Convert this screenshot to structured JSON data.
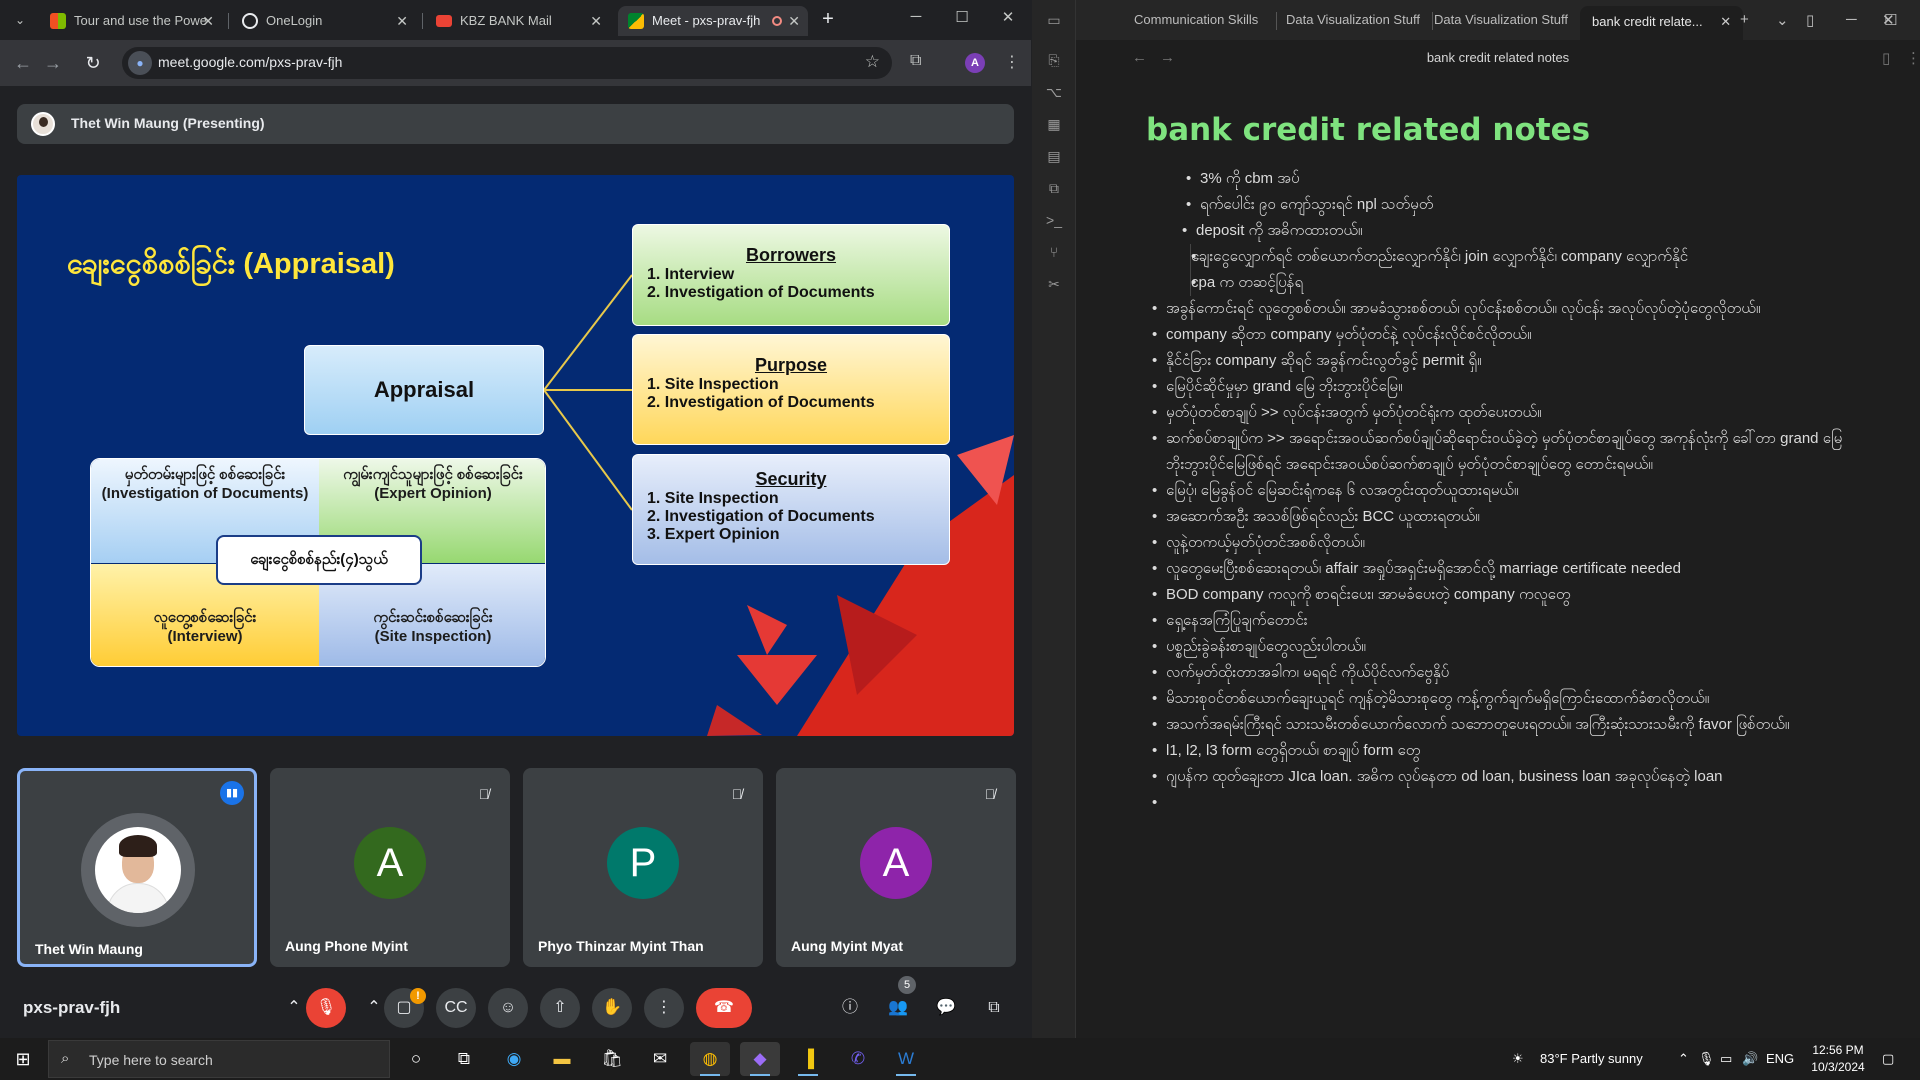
{
  "chrome": {
    "tabs": [
      {
        "label": "Tour and use the Powe",
        "active": false,
        "favicon_color": "#f25022"
      },
      {
        "label": "OneLogin",
        "active": false,
        "favicon_color": "#e8eaed"
      },
      {
        "label": "KBZ BANK Mail",
        "active": false,
        "favicon_color": "#ea4335"
      },
      {
        "label": "Meet - pxs-prav-fjh",
        "active": true,
        "favicon_color": "#00832d"
      }
    ],
    "url": "meet.google.com/pxs-prav-fjh",
    "profile_initial": "A"
  },
  "meet": {
    "presenter_label": "Thet Win Maung (Presenting)",
    "meeting_code": "pxs-prav-fjh",
    "participant_count": "5",
    "warning_count": "!",
    "slide": {
      "title": "ချေးငွေစိစစ်ခြင်း (Appraisal)",
      "center_label": "Appraisal",
      "borrowers": {
        "heading": "Borrowers",
        "items": [
          "1. Interview",
          "2. Investigation of Documents"
        ]
      },
      "purpose": {
        "heading": "Purpose",
        "items": [
          "1. Site Inspection",
          "2. Investigation of Documents"
        ]
      },
      "security": {
        "heading": "Security",
        "items": [
          "1. Site Inspection",
          "2. Investigation of Documents",
          "3. Expert Opinion"
        ]
      },
      "quadrants": {
        "top_left": {
          "mm": "မှတ်တမ်းများဖြင့် စစ်ဆေးခြင်း",
          "en": "(Investigation of Documents)"
        },
        "top_right": {
          "mm": "ကျွမ်းကျင်သူများဖြင့် စစ်ဆေးခြင်း",
          "en": "(Expert Opinion)"
        },
        "bottom_left": {
          "mm": "လူတွေ့စစ်ဆေးခြင်း",
          "en": "(Interview)"
        },
        "bottom_right": {
          "mm": "ကွင်းဆင်းစစ်ဆေးခြင်း",
          "en": "(Site Inspection)"
        },
        "center": "ချေးငွေစိစစ်နည်း(၄)သွယ်"
      }
    },
    "participants": [
      {
        "name": "Thet Win Maung",
        "initial": "",
        "color": "#5f6368",
        "active": true
      },
      {
        "name": "Aung Phone Myint",
        "initial": "A",
        "color": "#33691e",
        "active": false
      },
      {
        "name": "Phyo Thinzar Myint Than",
        "initial": "P",
        "color": "#00796b",
        "active": false
      },
      {
        "name": "Aung Myint Myat",
        "initial": "A",
        "color": "#8e24aa",
        "active": false
      }
    ]
  },
  "notes": {
    "tabs": [
      "Communication Skills",
      "Data Visualization Stuff",
      "Data Visualization Stuff",
      "bank credit relate..."
    ],
    "doc_header": "bank credit related notes",
    "title": "bank credit related notes",
    "items": [
      {
        "text": "3% ကို cbm အပ်",
        "level": "l3"
      },
      {
        "text": "ရက်ပေါင်း ၉၀ ကျော်သွားရင် npl သတ်မှတ်",
        "level": "l3"
      },
      {
        "text": "deposit ကို အဓိကထားတယ်။",
        "level": "l4"
      },
      {
        "text": "ချေးငွေလျှောက်ရင် တစ်ယောက်တည်းလျှောက်နိုင်၊ join လျှောက်နိုင်၊ company လျှောက်နိုင်",
        "level": "nested"
      },
      {
        "text": "cpa က တဆင့်ပြန်ရ",
        "level": "nested"
      },
      {
        "text": "အခွန်ကောင်းရင် လူတွေစစ်တယ်။ အာမခံသွားစစ်တယ်၊ လုပ်ငန်းစစ်တယ်။ လုပ်ငန်း အလုပ်လုပ်တဲ့ပုံတွေလိုတယ်။",
        "level": "l2"
      },
      {
        "text": "company ဆိုတာ company မှတ်ပုံတင်နဲ့ လုပ်ငန်းလိုင်စင်လိုတယ်။",
        "level": "l2"
      },
      {
        "text": "နိုင်ငံခြား company ဆိုရင် အခွန်ကင်းလွတ်ခွင့် permit ရှိ။",
        "level": "l2"
      },
      {
        "text": "မြေပိုင်ဆိုင်မှုမှာ grand မြေ ဘိုးဘွားပိုင်မြေ။",
        "level": "l2"
      },
      {
        "text": "မှတ်ပုံတင်စာချုပ် >> လုပ်ငန်းအတွက် မှတ်ပုံတင်ရုံးက ထုတ်ပေးတယ်။",
        "level": "l2"
      },
      {
        "text": "ဆက်စပ်စာချုပ်က >> အရောင်းအဝယ်ဆက်စပ်ချုပ်ဆိုရောင်းဝယ်ခဲ့တဲ့ မှတ်ပုံတင်စာချုပ်တွေ အကုန်လုံးကို ခေါ်တာ grand မြေ ဘိုးဘွားပိုင်မြေဖြစ်ရင် အရောင်းအဝယ်စပ်ဆက်စာချုပ် မှတ်ပုံတင်စာချုပ်တွေ တောင်းရမယ်။",
        "level": "l2"
      },
      {
        "text": "မြေပုံ၊ မြေခွန်ဝင် မြေဆင်းရုံကနေ ၆ လအတွင်းထုတ်ယူထားရမယ်။",
        "level": "l2"
      },
      {
        "text": "အဆောက်အဦး အသစ်ဖြစ်ရင်လည်း BCC ယူထားရတယ်။",
        "level": "l2"
      },
      {
        "text": "လူနဲ့တကယ့်မှတ်ပုံတင်အစစ်လိုတယ်။",
        "level": "l2"
      },
      {
        "text": "လူတွေမေးပြီးစစ်ဆေးရတယ်၊ affair အရှုပ်အရှင်းမရှိအောင်လို့ marriage certificate needed",
        "level": "l2"
      },
      {
        "text": "BOD company ကလူကို စာရင်းပေး၊ အာမခံပေးတဲ့ company ကလူတွေ",
        "level": "l2"
      },
      {
        "text": "ရှေ့နေအကြံပြုချက်တောင်း",
        "level": "l2"
      },
      {
        "text": "ပစ္စည်းခွဲခန်းစာချုပ်တွေလည်းပါတယ်။",
        "level": "l2"
      },
      {
        "text": "လက်မှတ်ထိုးတာအခါက၊ မရရင် ကိုယ်ပိုင်လက်ဗွေနှိပ်",
        "level": "l2"
      },
      {
        "text": "မိသားစုဝင်တစ်ယောက်ချေးယူရင် ကျန်တဲ့မိသားစုတွေ ကန့်ကွက်ချက်မရှိကြောင်းထောက်ခံစာလိုတယ်။",
        "level": "l2"
      },
      {
        "text": "အသက်အရမ်းကြီးရင် သားသမီးတစ်ယောက်လောက် သဘောတူပေးရတယ်။ အကြီးဆုံးသားသမီးကို favor ဖြစ်တယ်။",
        "level": "l2"
      },
      {
        "text": "l1, l2, l3 form တွေရှိတယ်၊ စာချုပ် form တွေ",
        "level": "l2"
      },
      {
        "text": "ဂျပန်က ထုတ်ချေးတာ JIca loan. အဓိက လုပ်နေတာ od loan, business loan အခုလုပ်နေတဲ့ loan",
        "level": "l2"
      },
      {
        "text": "",
        "level": "l2"
      }
    ]
  },
  "taskbar": {
    "search_placeholder": "Type here to search",
    "weather": "83°F  Partly sunny",
    "lang": "ENG",
    "time": "12:56 PM",
    "date": "10/3/2024"
  }
}
